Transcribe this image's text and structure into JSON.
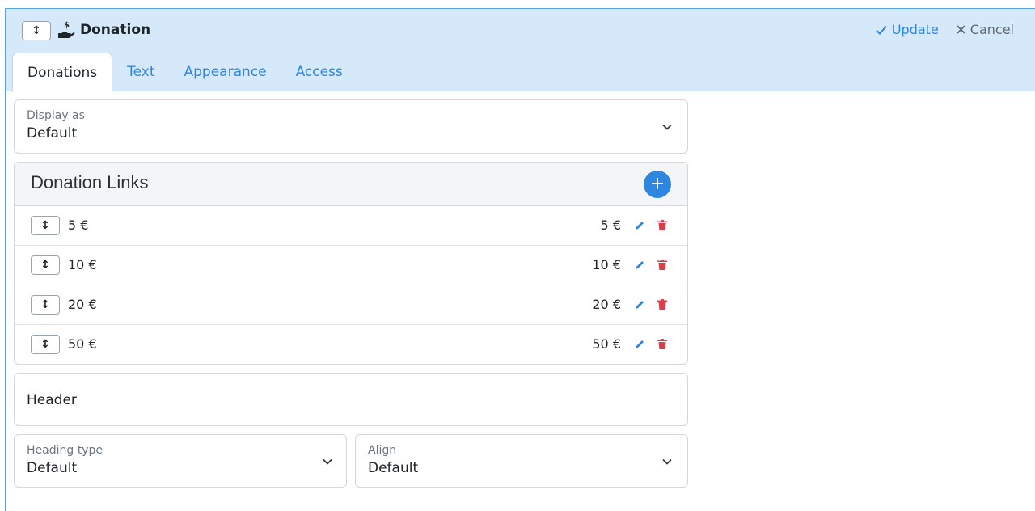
{
  "header": {
    "title": "Donation",
    "update_label": "Update",
    "cancel_label": "Cancel",
    "colors": {
      "accent": "#2f86de",
      "header_bg": "#d6e9fb",
      "danger": "#e03b4a"
    }
  },
  "tabs": [
    {
      "label": "Donations",
      "active": true
    },
    {
      "label": "Text",
      "active": false
    },
    {
      "label": "Appearance",
      "active": false
    },
    {
      "label": "Access",
      "active": false
    }
  ],
  "display_as": {
    "label": "Display as",
    "value": "Default"
  },
  "donation_links": {
    "title": "Donation Links",
    "add_icon": "plus-icon",
    "items": [
      {
        "label": "5 €",
        "amount": "5 €"
      },
      {
        "label": "10 €",
        "amount": "10 €"
      },
      {
        "label": "20 €",
        "amount": "20 €"
      },
      {
        "label": "50 €",
        "amount": "50 €"
      }
    ]
  },
  "header_field": {
    "value": "Header"
  },
  "heading_type": {
    "label": "Heading type",
    "value": "Default"
  },
  "align": {
    "label": "Align",
    "value": "Default"
  }
}
